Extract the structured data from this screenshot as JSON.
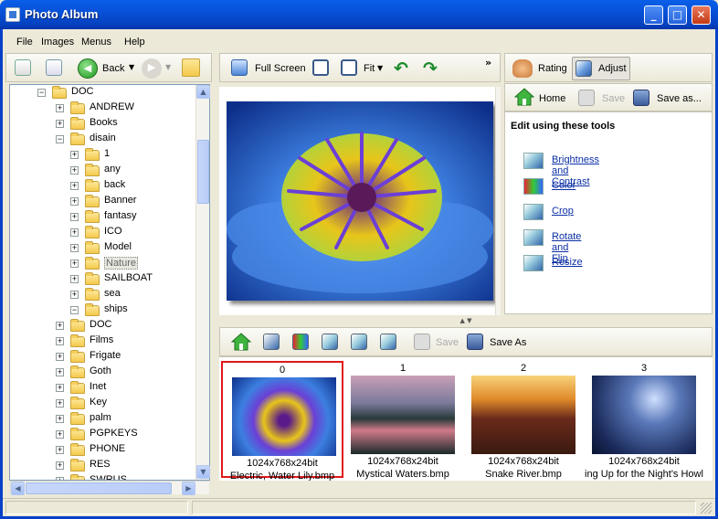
{
  "window": {
    "title": "Photo Album",
    "min": "_",
    "max": "□",
    "close": "✕"
  },
  "menu": [
    "File",
    "Images",
    "Menus",
    "Help"
  ],
  "tree_toolbar": {
    "back": "Back"
  },
  "viewer_toolbar": {
    "full_screen": "Full Screen",
    "fit": "Fit",
    "more": "»"
  },
  "right_tabs": {
    "rating": "Rating",
    "adjust": "Adjust"
  },
  "right_toolbar": {
    "home": "Home",
    "save": "Save",
    "save_as": "Save as..."
  },
  "edit_panel": {
    "heading": "Edit using these tools",
    "tools": [
      "Brightness and Contrast",
      "Color",
      "Crop",
      "Rotate and Flip",
      "Resize"
    ]
  },
  "thumb_toolbar": {
    "save": "Save",
    "save_as": "Save As"
  },
  "tree": [
    {
      "label": "DOC",
      "level": 0,
      "expander": "−"
    },
    {
      "label": "ANDREW",
      "level": 1,
      "expander": "+"
    },
    {
      "label": "Books",
      "level": 1,
      "expander": "+"
    },
    {
      "label": "disain",
      "level": 1,
      "expander": "−"
    },
    {
      "label": "1",
      "level": 2,
      "expander": "+"
    },
    {
      "label": "any",
      "level": 2,
      "expander": "+"
    },
    {
      "label": "back",
      "level": 2,
      "expander": "+"
    },
    {
      "label": "Banner",
      "level": 2,
      "expander": "+"
    },
    {
      "label": "fantasy",
      "level": 2,
      "expander": "+"
    },
    {
      "label": "ICO",
      "level": 2,
      "expander": "+"
    },
    {
      "label": "Model",
      "level": 2,
      "expander": "+"
    },
    {
      "label": "Nature",
      "level": 2,
      "expander": "+",
      "selected": true
    },
    {
      "label": "SAILBOAT",
      "level": 2,
      "expander": "+"
    },
    {
      "label": "sea",
      "level": 2,
      "expander": "+"
    },
    {
      "label": "ships",
      "level": 2,
      "expander": "−"
    },
    {
      "label": "DOC",
      "level": 1,
      "expander": "+"
    },
    {
      "label": "Films",
      "level": 1,
      "expander": "+"
    },
    {
      "label": "Frigate",
      "level": 1,
      "expander": "+"
    },
    {
      "label": "Goth",
      "level": 1,
      "expander": "+"
    },
    {
      "label": "Inet",
      "level": 1,
      "expander": "+"
    },
    {
      "label": "Key",
      "level": 1,
      "expander": "+"
    },
    {
      "label": "palm",
      "level": 1,
      "expander": "+"
    },
    {
      "label": "PGPKEYS",
      "level": 1,
      "expander": "+"
    },
    {
      "label": "PHONE",
      "level": 1,
      "expander": "+"
    },
    {
      "label": "RES",
      "level": 1,
      "expander": "+"
    },
    {
      "label": "SWRUS",
      "level": 1,
      "expander": "+"
    }
  ],
  "thumbnails": [
    {
      "index": "0",
      "res": "1024x768x24bit",
      "name": "Electric, Water Lily.bmp",
      "selected": true
    },
    {
      "index": "1",
      "res": "1024x768x24bit",
      "name": "Mystical Waters.bmp"
    },
    {
      "index": "2",
      "res": "1024x768x24bit",
      "name": "Snake River.bmp"
    },
    {
      "index": "3",
      "res": "1024x768x24bit",
      "name": "ing Up for the Night's Howl"
    }
  ],
  "colors": {
    "title": "#0751d8",
    "link": "#0b2fa5",
    "selection": "#e01818"
  }
}
